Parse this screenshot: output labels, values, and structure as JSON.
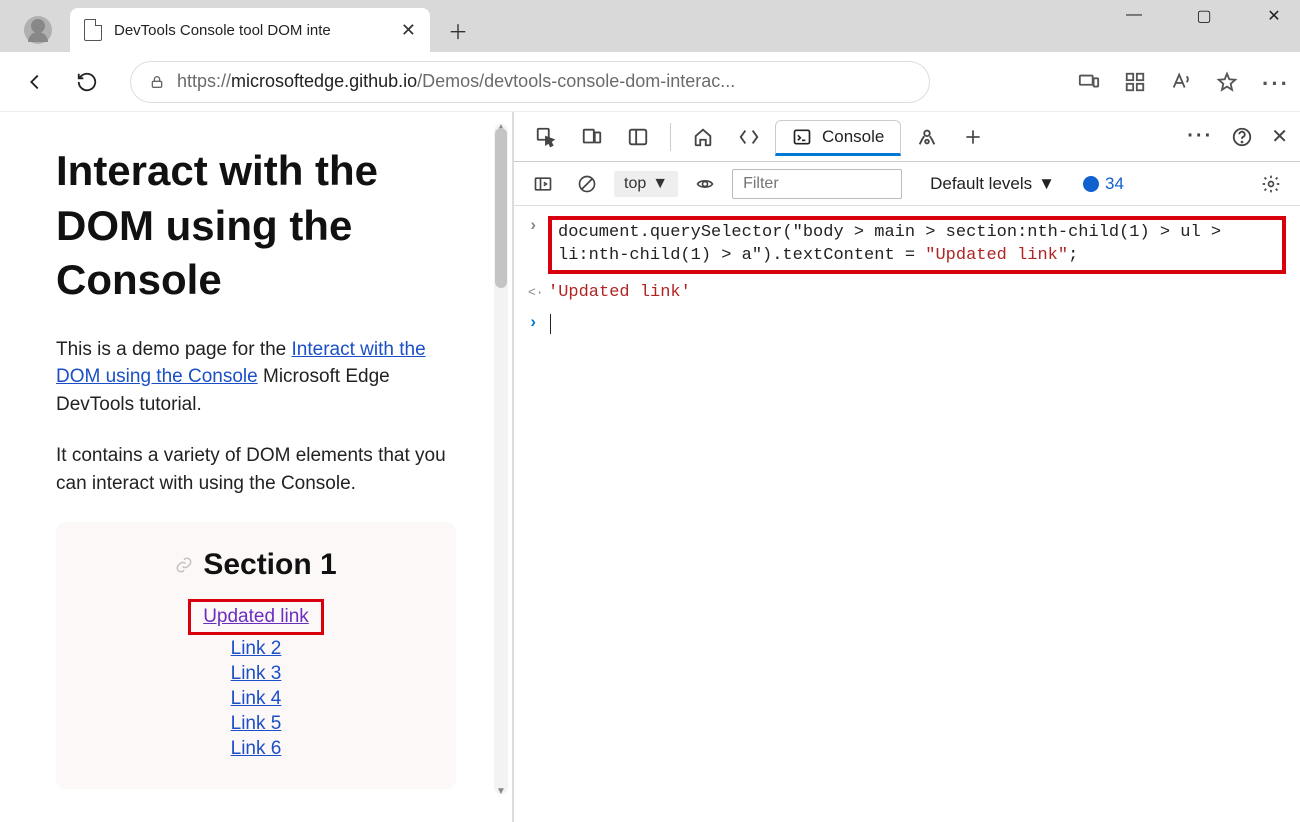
{
  "browser": {
    "tab_title": "DevTools Console tool DOM inte",
    "url_prefix": "https://",
    "url_host": "microsoftedge.github.io",
    "url_path": "/Demos/devtools-console-dom-interac..."
  },
  "page": {
    "h1": "Interact with the DOM using the Console",
    "intro_1a": "This is a demo page for the ",
    "intro_link": "Interact with the DOM using the Console",
    "intro_1b": " Microsoft Edge DevTools tutorial.",
    "intro_2": "It contains a variety of DOM elements that you can interact with using the Console.",
    "section_title": "Section 1",
    "links": [
      "Updated link",
      "Link 2",
      "Link 3",
      "Link 4",
      "Link 5",
      "Link 6"
    ]
  },
  "devtools": {
    "active_tab": "Console",
    "context": "top",
    "filter_placeholder": "Filter",
    "levels_label": "Default levels",
    "issues_count": "34",
    "input_code_line1": "document.querySelector(\"body > main > section:nth-child(1) > ul >",
    "input_code_line2_a": "li:nth-child(1) > a\").textContent = ",
    "input_code_line2_b": "\"Updated link\"",
    "input_code_line2_c": ";",
    "result": "'Updated link'"
  }
}
